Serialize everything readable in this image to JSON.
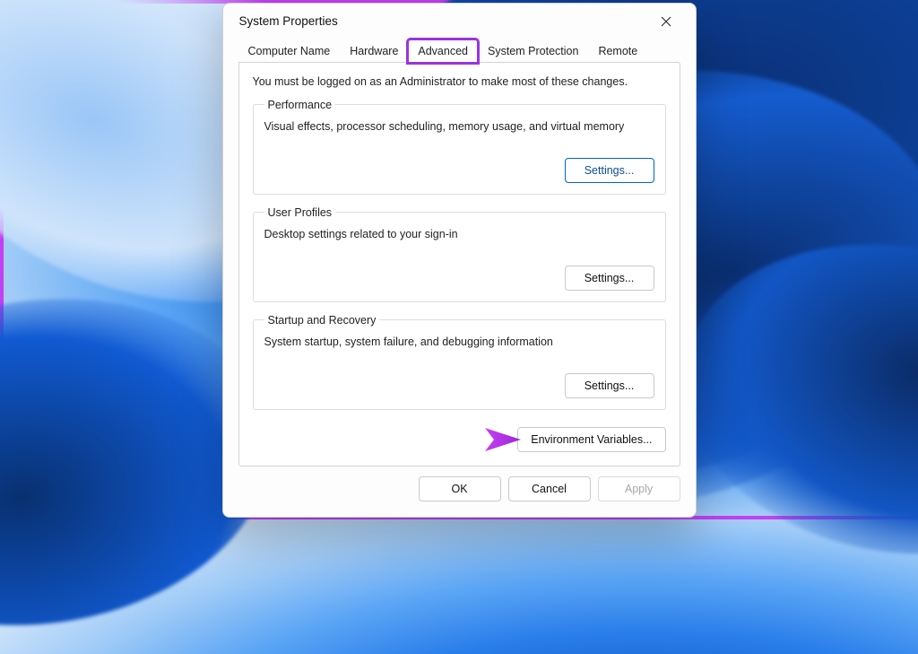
{
  "dialog": {
    "title": "System Properties"
  },
  "tabs": {
    "computer_name": "Computer Name",
    "hardware": "Hardware",
    "advanced": "Advanced",
    "system_protection": "System Protection",
    "remote": "Remote"
  },
  "advanced_panel": {
    "admin_note": "You must be logged on as an Administrator to make most of these changes.",
    "performance": {
      "legend": "Performance",
      "desc": "Visual effects, processor scheduling, memory usage, and virtual memory",
      "settings_btn": "Settings..."
    },
    "user_profiles": {
      "legend": "User Profiles",
      "desc": "Desktop settings related to your sign-in",
      "settings_btn": "Settings..."
    },
    "startup_recovery": {
      "legend": "Startup and Recovery",
      "desc": "System startup, system failure, and debugging information",
      "settings_btn": "Settings..."
    },
    "env_vars_btn": "Environment Variables..."
  },
  "footer": {
    "ok": "OK",
    "cancel": "Cancel",
    "apply": "Apply"
  }
}
